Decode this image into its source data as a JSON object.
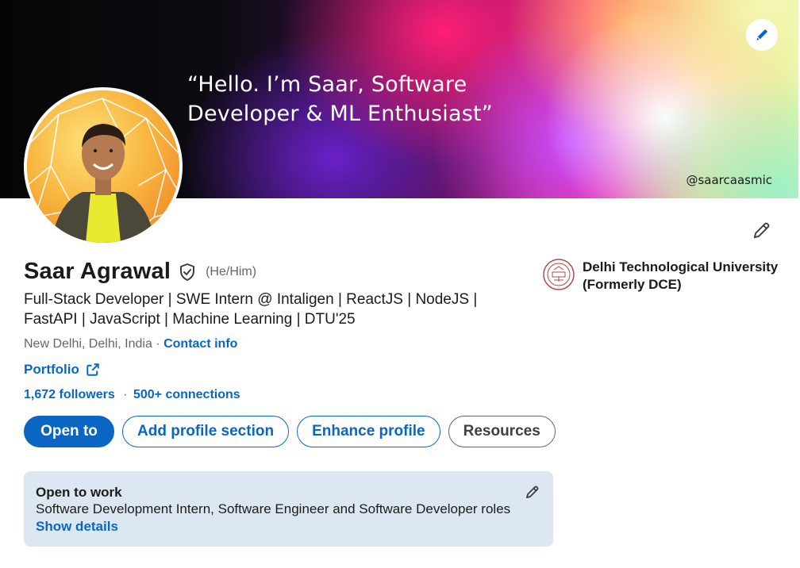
{
  "banner": {
    "quote_line1": "“Hello. I’m Saar, Software",
    "quote_line2": "Developer & ML Enthusiast”",
    "handle": "@saarcaasmic"
  },
  "profile": {
    "name": "Saar Agrawal",
    "pronouns": "(He/Him)",
    "headline": "Full-Stack Developer | SWE Intern @ Intaligen | ReactJS | NodeJS | FastAPI | JavaScript | Machine Learning | DTU'25",
    "location": "New Delhi, Delhi, India",
    "location_separator": "·",
    "contact_info_label": "Contact info",
    "portfolio_label": "Portfolio",
    "followers_label": "1,672 followers",
    "stats_separator": "·",
    "connections_label": "500+ connections"
  },
  "actions": {
    "open_to": "Open to",
    "add_section": "Add profile section",
    "enhance": "Enhance profile",
    "resources": "Resources"
  },
  "education": {
    "name": "Delhi Technological University (Formerly DCE)"
  },
  "open_to_work": {
    "title": "Open to work",
    "description": "Software Development Intern, Software Engineer and Software Developer roles",
    "show_details": "Show details"
  },
  "colors": {
    "accent": "#0a66c2",
    "otw_background": "#dde7f1",
    "text_primary": "#1b1b1b",
    "text_secondary": "#666666"
  },
  "icons": {
    "banner_edit": "pencil-icon",
    "intro_edit": "pencil-icon",
    "verified": "shield-check-icon",
    "portfolio_external": "external-link-icon",
    "otw_edit": "pencil-icon"
  }
}
